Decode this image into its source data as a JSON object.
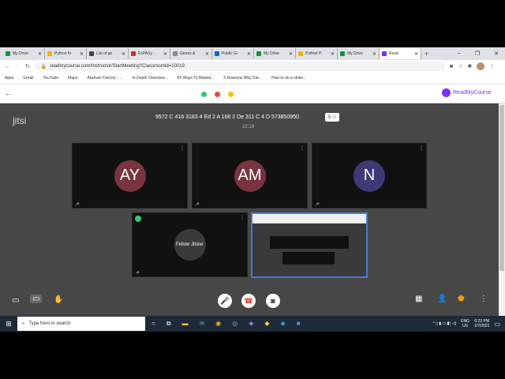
{
  "browser": {
    "tabs": [
      {
        "label": "My Drive",
        "color": "#1e8e3e"
      },
      {
        "label": "Python fo",
        "color": "#f4b400"
      },
      {
        "label": "List of ge",
        "color": "#444"
      },
      {
        "label": "ExPASy -",
        "color": "#d32f2f"
      },
      {
        "label": "Genes &",
        "color": "#888"
      },
      {
        "label": "Public Gi",
        "color": "#1565c0"
      },
      {
        "label": "My Drive",
        "color": "#1e8e3e"
      },
      {
        "label": "Python P",
        "color": "#f4b400"
      },
      {
        "label": "My Drive",
        "color": "#1e8e3e"
      },
      {
        "label": "Read",
        "color": "#7b2ff7",
        "active": true
      }
    ],
    "url": "readmycourse.com/Instructor/StartMeeting?ClassroomId=10019",
    "bookmarks": [
      "Apps",
      "Gmail",
      "YouTube",
      "Maps",
      "Abstract Factory - ...",
      "In-Depth Overview...",
      "55 Ways To Market...",
      "5 Reasons Why Dat...",
      "How to do a strike..."
    ]
  },
  "page": {
    "brand": "ReadMyCourse",
    "back": "←"
  },
  "meeting": {
    "logo": "jitsi",
    "title": "9572 C 416 3183 4 Ed 2 A 166 2 De 311 C 4 D 573850950",
    "participant_count": "5",
    "timer": "22:19",
    "participants": [
      {
        "initials": "AY",
        "color": "#7a3340"
      },
      {
        "initials": "AM",
        "color": "#7a3340"
      },
      {
        "initials": "N",
        "color": "#3e3a78"
      }
    ],
    "local_name": "Fellow Jitster"
  },
  "taskbar": {
    "search_placeholder": "Type here to search",
    "lang": "ENG",
    "region": "US",
    "time": "6:22 PM",
    "date": "1/7/2021"
  }
}
